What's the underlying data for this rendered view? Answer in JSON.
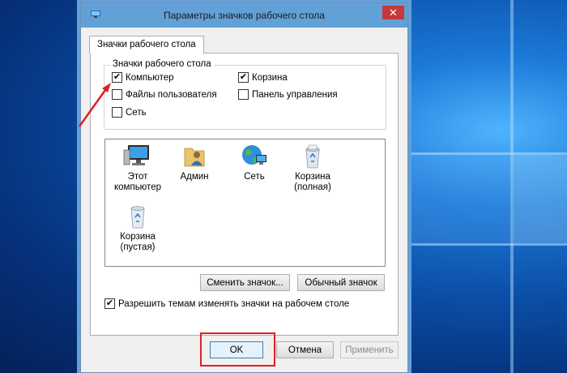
{
  "window": {
    "title": "Параметры значков рабочего стола",
    "close_glyph": "✕"
  },
  "tab": {
    "label": "Значки рабочего стола"
  },
  "group": {
    "legend": "Значки рабочего стола",
    "checkboxes": [
      {
        "label": "Компьютер",
        "checked": true
      },
      {
        "label": "Корзина",
        "checked": true
      },
      {
        "label": "Файлы пользователя",
        "checked": false
      },
      {
        "label": "Панель управления",
        "checked": false
      },
      {
        "label": "Сеть",
        "checked": false
      }
    ]
  },
  "icons": [
    {
      "line1": "Этот",
      "line2": "компьютер",
      "icon": "computer-icon"
    },
    {
      "line1": "Админ",
      "line2": "",
      "icon": "user-folder-icon"
    },
    {
      "line1": "Сеть",
      "line2": "",
      "icon": "network-icon"
    },
    {
      "line1": "Корзина",
      "line2": "(полная)",
      "icon": "recycle-bin-full-icon"
    },
    {
      "line1": "Корзина",
      "line2": "(пустая)",
      "icon": "recycle-bin-empty-icon"
    }
  ],
  "buttons": {
    "change_icon": "Сменить значок...",
    "default_icon": "Обычный значок",
    "ok": "OK",
    "cancel": "Отмена",
    "apply": "Применить"
  },
  "themes_checkbox": {
    "label": "Разрешить темам изменять значки на рабочем столе",
    "checked": true
  },
  "check_glyph": "✔",
  "colors": {
    "titlebar": "#62a0d8",
    "close_button": "#c7383b",
    "highlight": "#e01f26"
  }
}
